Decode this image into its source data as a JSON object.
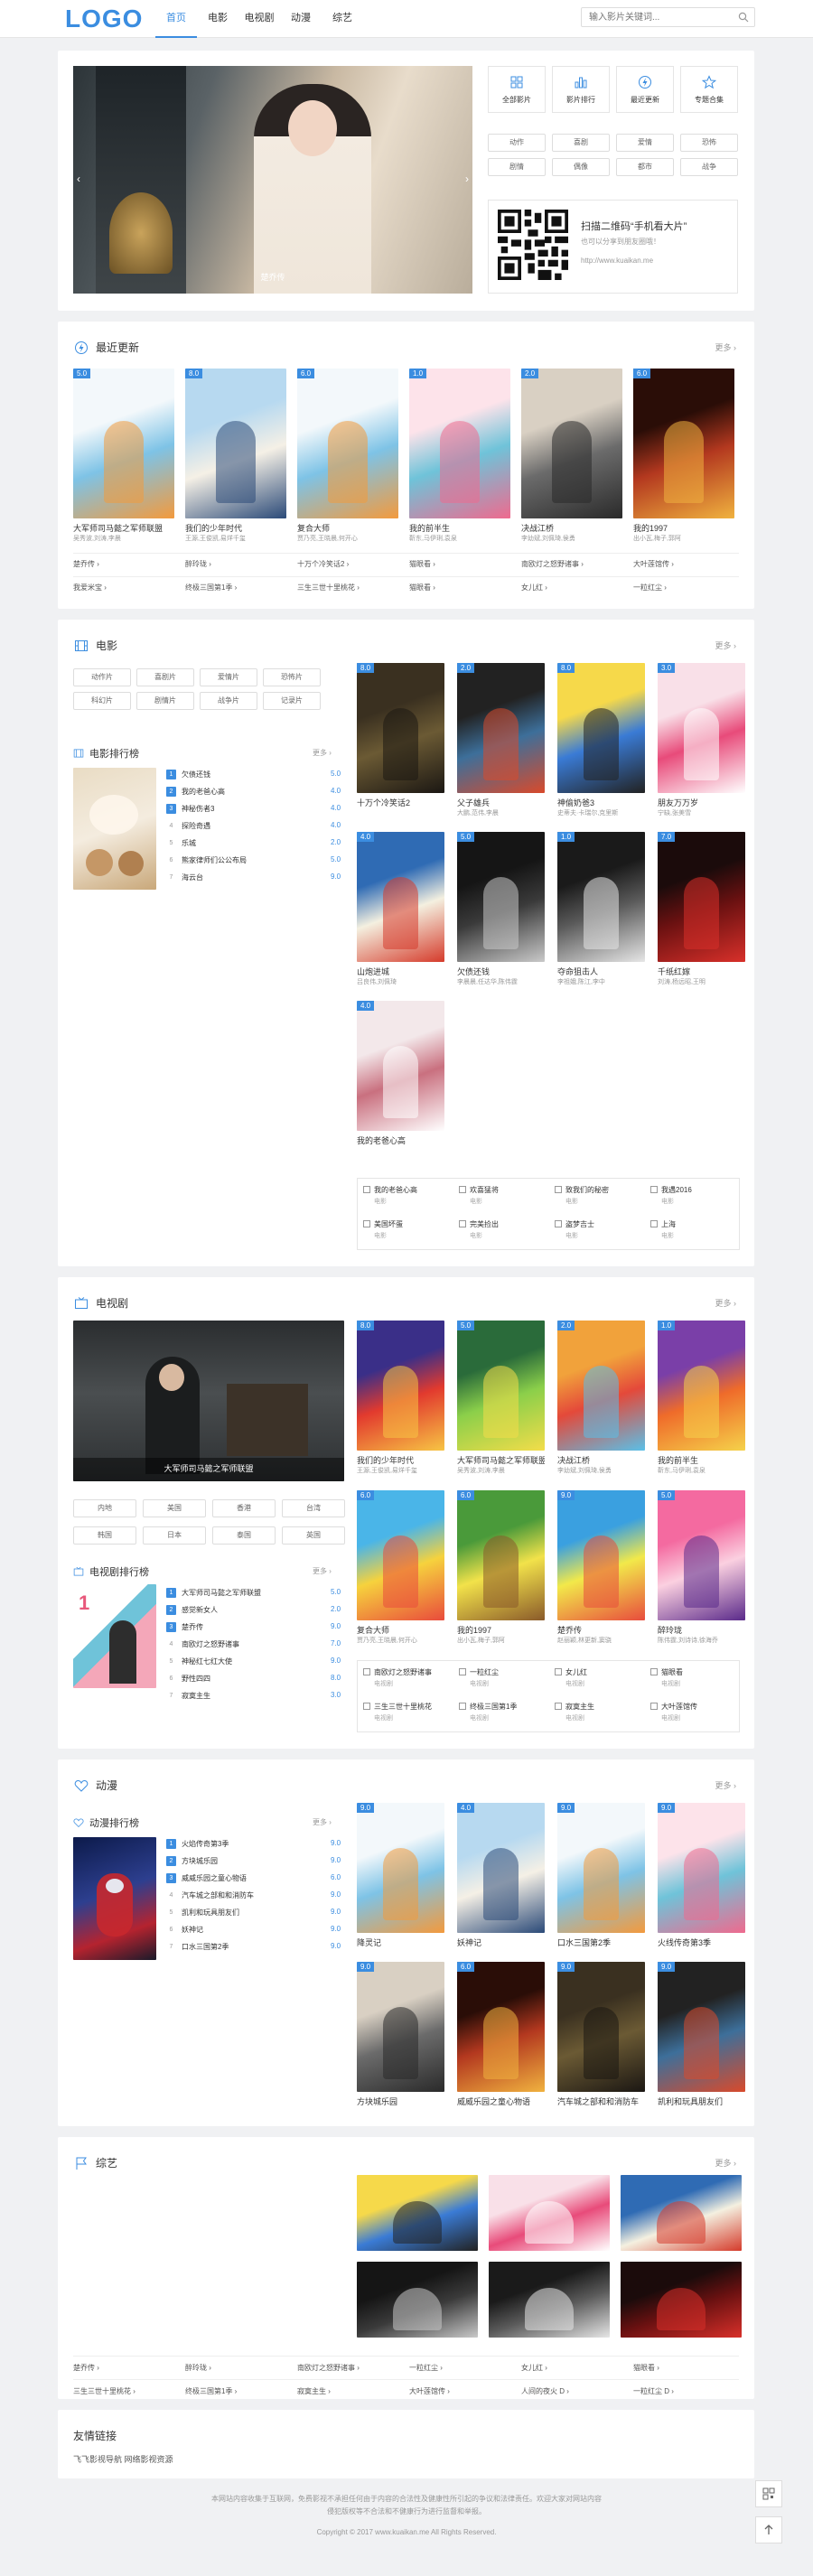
{
  "logo": "LOGO",
  "nav": [
    "首页",
    "电影",
    "电视剧",
    "动漫",
    "综艺"
  ],
  "search": {
    "placeholder": "输入影片关键词..."
  },
  "hero": {
    "caption": "楚乔传",
    "quick_links": [
      "全部影片",
      "影片排行",
      "最近更新",
      "专题合集"
    ],
    "tags": [
      "动作",
      "喜剧",
      "爱情",
      "恐怖",
      "剧情",
      "偶像",
      "都市",
      "战争"
    ],
    "qr_title": "扫描二维码“手机看大片”",
    "qr_sub": "也可以分享到朋友圈哦！",
    "qr_url": "http://www.kuaikan.me"
  },
  "recent": {
    "title": "最近更新",
    "more": "更多",
    "posters": [
      {
        "badge": "5.0",
        "title": "大军师司马懿之军师联盟",
        "sub": "吴秀波,刘涛,李晨"
      },
      {
        "badge": "8.0",
        "title": "我们的少年时代",
        "sub": "王源,王俊凯,易烊千玺"
      },
      {
        "badge": "6.0",
        "title": "复合大师",
        "sub": "贾乃亮,王晓晨,何开心"
      },
      {
        "badge": "1.0",
        "title": "我的前半生",
        "sub": "靳东,马伊琍,袁泉"
      },
      {
        "badge": "2.0",
        "title": "决战江桥",
        "sub": "李幼斌,刘佩琦,侯勇"
      },
      {
        "badge": "6.0",
        "title": "我的1997",
        "sub": "出小瓦,梅子,郭阿"
      }
    ],
    "links": [
      [
        "楚乔传",
        "醉玲珑",
        "十万个冷笑话2",
        "猫眼看",
        "南欧灯之怒野诸事",
        "大叶莲馆传"
      ],
      [
        "我爱米宝",
        "终极三国第1季",
        "三生三世十里桃花",
        "猫眼看",
        "女儿红",
        "一粒红尘"
      ]
    ]
  },
  "movie": {
    "title": "电影",
    "more": "更多",
    "tags": [
      "动作片",
      "喜剧片",
      "爱情片",
      "恐怖片",
      "科幻片",
      "剧情片",
      "战争片",
      "记录片"
    ],
    "rank_title": "电影排行榜",
    "rank_more": "更多",
    "rank": [
      {
        "n": "1",
        "t": "欠债还钱",
        "s": "5.0"
      },
      {
        "n": "2",
        "t": "我的老爸心高",
        "s": "4.0"
      },
      {
        "n": "3",
        "t": "神秘伤者3",
        "s": "4.0"
      },
      {
        "n": "4",
        "t": "探险奇遇",
        "s": "4.0"
      },
      {
        "n": "5",
        "t": "乐城",
        "s": "2.0"
      },
      {
        "n": "6",
        "t": "熊家律师们公公布局",
        "s": "5.0"
      },
      {
        "n": "7",
        "t": "海云台",
        "s": "9.0"
      }
    ],
    "posters": [
      {
        "badge": "8.0",
        "title": "十万个冷笑话2",
        "sub": ""
      },
      {
        "badge": "2.0",
        "title": "父子雄兵",
        "sub": "大鹏,范伟,李晨"
      },
      {
        "badge": "8.0",
        "title": "神偷奶爸3",
        "sub": "史蒂夫·卡瑞尔,克里斯"
      },
      {
        "badge": "3.0",
        "title": "朋友万万岁",
        "sub": "宁缺,张美雪"
      },
      {
        "badge": "4.0",
        "title": "山炮进城",
        "sub": "吕良伟,刘佩琦"
      },
      {
        "badge": "5.0",
        "title": "欠债还钱",
        "sub": "李晨晨,任达华,陈伟霆"
      },
      {
        "badge": "1.0",
        "title": "夺命狙击人",
        "sub": "李祖娥,陈江,李中"
      },
      {
        "badge": "7.0",
        "title": "千纸红嫁",
        "sub": "刘涛,杨远昭,王明"
      },
      {
        "badge": "4.0",
        "title": "我的老爸心高",
        "sub": ""
      }
    ],
    "grid": [
      [
        "我的老爸心高",
        "欢喜猛将",
        "致我们的秘密",
        "我遇2016"
      ],
      [
        "美国坏蛋",
        "完美捡出",
        "盗梦吉士",
        "上海"
      ]
    ],
    "grid_sub": "电影"
  },
  "tv": {
    "title": "电视剧",
    "more": "更多",
    "banner_caption": "大军师司马懿之军师联盟",
    "tags": [
      "内地",
      "美国",
      "香港",
      "台湾",
      "韩国",
      "日本",
      "泰国",
      "英国"
    ],
    "rank_title": "电视剧排行榜",
    "rank_more": "更多",
    "rank": [
      {
        "n": "1",
        "t": "大军师司马懿之军师联盟",
        "s": "5.0"
      },
      {
        "n": "2",
        "t": "感觉新女人",
        "s": "2.0"
      },
      {
        "n": "3",
        "t": "楚乔传",
        "s": "9.0"
      },
      {
        "n": "4",
        "t": "南欧灯之怒野诸事",
        "s": "7.0"
      },
      {
        "n": "5",
        "t": "神秘红七红大使",
        "s": "9.0"
      },
      {
        "n": "6",
        "t": "野性四四",
        "s": "8.0"
      },
      {
        "n": "7",
        "t": "寂寞主生",
        "s": "3.0"
      }
    ],
    "posters": [
      {
        "badge": "8.0",
        "title": "我们的少年时代",
        "sub": "王源,王俊凯,易烊千玺"
      },
      {
        "badge": "5.0",
        "title": "大军师司马懿之军师联盟",
        "sub": "吴秀波,刘涛,李晨"
      },
      {
        "badge": "2.0",
        "title": "决战江桥",
        "sub": "李幼斌,刘佩琦,侯勇"
      },
      {
        "badge": "1.0",
        "title": "我的前半生",
        "sub": "靳东,马伊琍,袁泉"
      },
      {
        "badge": "6.0",
        "title": "复合大师",
        "sub": "贾乃亮,王晓晨,何开心"
      },
      {
        "badge": "6.0",
        "title": "我的1997",
        "sub": "出小瓦,梅子,郭阿"
      },
      {
        "badge": "9.0",
        "title": "楚乔传",
        "sub": "赵丽颖,林更新,窦骁"
      },
      {
        "badge": "5.0",
        "title": "醉玲珑",
        "sub": "陈伟霆,刘诗诗,徐海乔"
      }
    ],
    "grid": [
      [
        "南欧灯之怒野诸事",
        "一粒红尘",
        "女儿红",
        "猫眼看"
      ],
      [
        "三生三世十里桃花",
        "终极三国第1季",
        "寂寞主生",
        "大叶莲馆传"
      ]
    ],
    "grid_sub": "电视剧"
  },
  "anime": {
    "title": "动漫",
    "more": "更多",
    "rank_title": "动漫排行榜",
    "rank_more": "更多",
    "rank": [
      {
        "n": "1",
        "t": "火焰传奇第3季",
        "s": "9.0"
      },
      {
        "n": "2",
        "t": "方块城乐园",
        "s": "9.0"
      },
      {
        "n": "3",
        "t": "威威乐园之童心物语",
        "s": "6.0"
      },
      {
        "n": "4",
        "t": "汽车城之部和和消防车",
        "s": "9.0"
      },
      {
        "n": "5",
        "t": "凯利和玩具朋友们",
        "s": "9.0"
      },
      {
        "n": "6",
        "t": "妖神记",
        "s": "9.0"
      },
      {
        "n": "7",
        "t": "口水三国第2季",
        "s": "9.0"
      }
    ],
    "posters": [
      {
        "badge": "9.0",
        "title": "降灵记",
        "sub": ""
      },
      {
        "badge": "4.0",
        "title": "妖神记",
        "sub": ""
      },
      {
        "badge": "9.0",
        "title": "口水三国第2季",
        "sub": ""
      },
      {
        "badge": "9.0",
        "title": "火线传奇第3季",
        "sub": ""
      },
      {
        "badge": "9.0",
        "title": "方块城乐园",
        "sub": ""
      },
      {
        "badge": "6.0",
        "title": "威威乐园之童心物语",
        "sub": ""
      },
      {
        "badge": "9.0",
        "title": "汽车城之部和和消防车",
        "sub": ""
      },
      {
        "badge": "9.0",
        "title": "凯利和玩具朋友们",
        "sub": ""
      }
    ]
  },
  "variety": {
    "title": "综艺",
    "more": "更多",
    "tiles": [
      "",
      "",
      "",
      "",
      "",
      ""
    ],
    "links": [
      [
        "楚乔传",
        "醉玲珑",
        "南欧灯之怒野诸事",
        "一粒红尘",
        "女儿红",
        "猫眼看"
      ],
      [
        "三生三世十里桃花",
        "终极三国第1季",
        "寂寞主生",
        "大叶莲馆传",
        "人间的夜火 D",
        "一粒红尘 D"
      ]
    ]
  },
  "friends": {
    "title": "友情链接",
    "links": "飞飞影视导航  网络影视资源"
  },
  "footer": {
    "line1": "本网站内容收集于互联网，免费影视不承担任何由于内容的合法性及健康性所引起的争议和法律责任。欢迎大家对网站内容",
    "line2": "侵犯版权等不合法和不健康行为进行监督和举报。",
    "copyright": "Copyright © 2017 www.kuaikan.me All Rights Reserved."
  },
  "colors": {
    "accent": "#3b8de0",
    "bg": "#f0f1f3"
  }
}
